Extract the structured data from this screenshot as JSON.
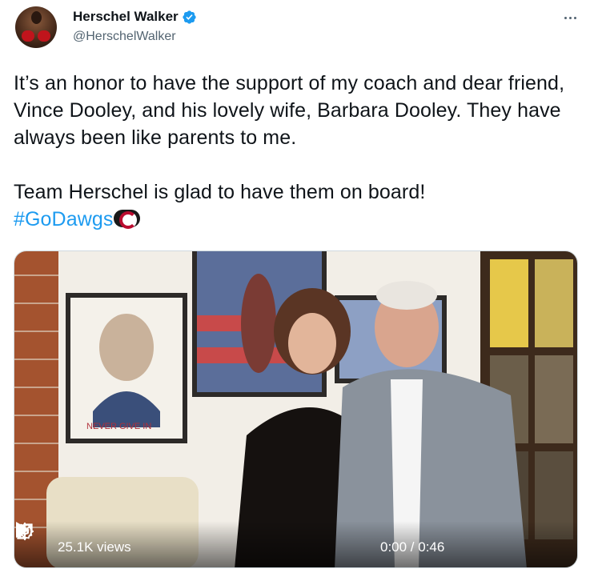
{
  "author": {
    "display_name": "Herschel Walker",
    "handle": "@HerschelWalker",
    "verified": true,
    "avatar_icon": "boxer-avatar"
  },
  "tweet": {
    "paragraph1": "It’s an honor to have the support of my coach and dear friend, Vince Dooley, and his lovely wife, Barbara Dooley. They have always been like parents to me.",
    "paragraph2": "Team Herschel is glad to have them on board!",
    "hashtag": "#GoDawgs",
    "hashtag_emoji": "georgia-g-logo"
  },
  "video": {
    "views": "25.1K views",
    "time": "0:00 / 0:46",
    "progress": 0
  },
  "colors": {
    "link": "#1d9bf0",
    "text": "#0f1419",
    "secondary": "#536471",
    "verified": "#1d9bf0"
  }
}
